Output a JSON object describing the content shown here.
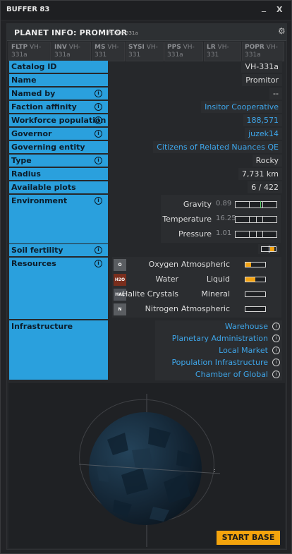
{
  "window": {
    "title": "BUFFER 83",
    "minimize": "_",
    "close": "X"
  },
  "panel": {
    "title": "PLANET INFO: PROMITOR",
    "subtitle": "PLI VH-331a"
  },
  "tabs": [
    {
      "code": "FLTP",
      "ref": "VH-331a"
    },
    {
      "code": "INV",
      "ref": "VH-331a"
    },
    {
      "code": "MS",
      "ref": "VH-331"
    },
    {
      "code": "SYSI",
      "ref": "VH-331"
    },
    {
      "code": "PPS",
      "ref": "VH-331a"
    },
    {
      "code": "LR",
      "ref": "VH-331"
    },
    {
      "code": "POPR",
      "ref": "VH-331a"
    }
  ],
  "fields": {
    "catalog_id": {
      "label": "Catalog ID",
      "value": "VH-331a"
    },
    "name": {
      "label": "Name",
      "value": "Promitor"
    },
    "named_by": {
      "label": "Named by",
      "value": "--"
    },
    "faction": {
      "label": "Faction affinity",
      "value": "Insitor Cooperative"
    },
    "workforce": {
      "label": "Workforce population",
      "value": "188,571"
    },
    "governor": {
      "label": "Governor",
      "value": "juzek14"
    },
    "governing_entity": {
      "label": "Governing entity",
      "value": "Citizens of Related Nuances QE"
    },
    "type": {
      "label": "Type",
      "value": "Rocky"
    },
    "radius": {
      "label": "Radius",
      "value": "7,731 km"
    },
    "plots": {
      "label": "Available plots",
      "value": "6 / 422"
    },
    "environment": {
      "label": "Environment"
    },
    "soil": {
      "label": "Soil fertility"
    },
    "resources": {
      "label": "Resources"
    },
    "infrastructure": {
      "label": "Infrastructure"
    }
  },
  "info_glyph": "i",
  "environment": [
    {
      "name": "Gravity",
      "value": "0.89",
      "level": 0.6
    },
    {
      "name": "Temperature",
      "value": "16.25",
      "level": 0.5
    },
    {
      "name": "Pressure",
      "value": "1.01",
      "level": 0.5
    }
  ],
  "soil_level": 0.7,
  "resources": [
    {
      "ticker": "O",
      "name": "Oxygen",
      "type": "Atmospheric",
      "fill": 0.3,
      "color": "#5a5d61"
    },
    {
      "ticker": "H2O",
      "name": "Water",
      "type": "Liquid",
      "fill": 0.5,
      "color": "#7a2e1d"
    },
    {
      "ticker": "HAL",
      "name": "Halite Crystals",
      "type": "Mineral",
      "fill": 0.0,
      "color": "#4f5258"
    },
    {
      "ticker": "N",
      "name": "Nitrogen",
      "type": "Atmospheric",
      "fill": 0.0,
      "color": "#5a5d61"
    }
  ],
  "infrastructure": [
    "Warehouse",
    "Planetary Administration Center",
    "Local Market",
    "Population Infrastructure",
    "Chamber of Global Commerce"
  ],
  "start_base_label": "START BASE",
  "colors": {
    "accent": "#2aa0dd",
    "link": "#3ea6ea",
    "button": "#f4a40d",
    "bar_fill": "#f2a212",
    "gravity_marker": "#5bd16a"
  }
}
